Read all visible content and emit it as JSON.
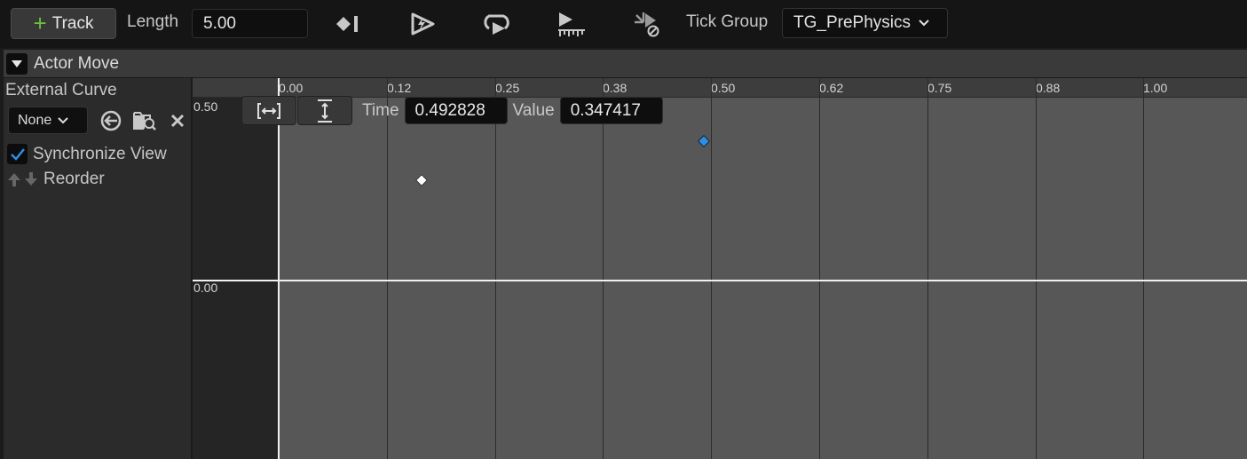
{
  "toolbar": {
    "add_track_label": "Track",
    "length_label": "Length",
    "length_value": "5.00",
    "icons": [
      "use-last-keyframe-icon",
      "autoplay-icon",
      "loop-icon",
      "replicated-icon",
      "ignore-time-dilation-icon"
    ],
    "tick_group_label": "Tick Group",
    "tick_group_value": "TG_PrePhysics"
  },
  "track": {
    "name": "Actor Move",
    "external_curve_label": "External Curve",
    "curve_select_value": "None",
    "synchronize_view_label": "Synchronize View",
    "synchronize_view_checked": true,
    "reorder_label": "Reorder"
  },
  "graph": {
    "x_ticks": [
      "0.00",
      "0.12",
      "0.25",
      "0.38",
      "0.50",
      "0.62",
      "0.75",
      "0.88",
      "1.00"
    ],
    "y_labels": [
      "0.50",
      "0.00"
    ],
    "time_label": "Time",
    "time_value": "0.492828",
    "value_label": "Value",
    "value_value": "0.347417",
    "keyframes": [
      {
        "time": 0.166,
        "value": 0.25,
        "selected": false
      },
      {
        "time": 0.493,
        "value": 0.347,
        "selected": true
      }
    ],
    "colors": {
      "curve_bg": "#575757",
      "selected_key": "#2a8fe8",
      "unselected_key": "#ffffff",
      "axis": "#f0f0f0"
    }
  }
}
